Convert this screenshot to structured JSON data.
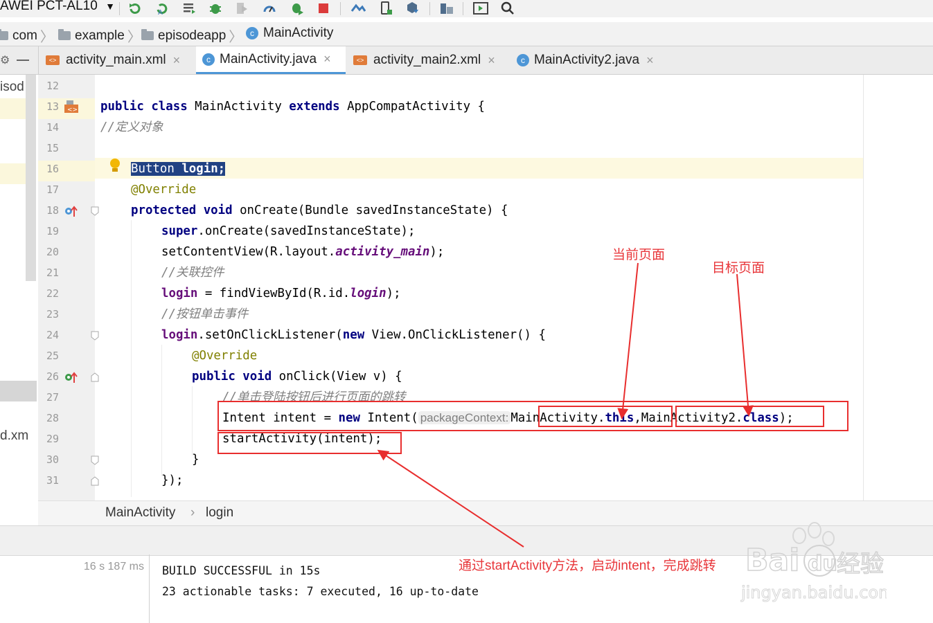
{
  "toolbar": {
    "device": "AWEI PCT-AL10"
  },
  "breadcrumb": {
    "c1": "com",
    "c2": "example",
    "c3": "episodeapp",
    "c4": "MainActivity"
  },
  "tabs": [
    {
      "label": "activity_main.xml"
    },
    {
      "label": "MainActivity.java"
    },
    {
      "label": "activity_main2.xml"
    },
    {
      "label": "MainActivity2.java"
    }
  ],
  "left_panel": {
    "t1": "isod",
    "t2": "d.xm"
  },
  "lines": [
    "12",
    "13",
    "14",
    "15",
    "16",
    "17",
    "18",
    "19",
    "20",
    "21",
    "22",
    "23",
    "24",
    "25",
    "26",
    "27",
    "28",
    "29",
    "30",
    "31"
  ],
  "code": {
    "l13_public": "public",
    "l13_class": "class",
    "l13_name": "MainActivity",
    "l13_extends": "extends",
    "l13_rest": "AppCompatActivity {",
    "l14": "//定义对象",
    "l16_sel": "Button",
    "l16_name": "login;",
    "l17": "@Override",
    "l18_kw": "protected void",
    "l18_rest": "onCreate(Bundle savedInstanceState) {",
    "l19_super": "super",
    "l19_rest": ".onCreate(savedInstanceState);",
    "l20_a": "setContentView(R.layout.",
    "l20_b": "activity_main",
    "l20_c": ");",
    "l21": "//关联控件",
    "l22_f": "login",
    "l22_a": " = findViewById(R.id.",
    "l22_b": "login",
    "l22_c": ");",
    "l23": "//按钮单击事件",
    "l24_f": "login",
    "l24_a": ".setOnClickListener(",
    "l24_new": "new",
    "l24_b": " View.OnClickListener() {",
    "l25": "@Override",
    "l26_kw": "public void",
    "l26_rest": "onClick(View v) {",
    "l27": "//单击登陆按钮后进行页面的跳转",
    "l28_a": "Intent intent = ",
    "l28_new": "new",
    "l28_b": " Intent(",
    "l28_hint": "packageContext:",
    "l28_c": "MainActivity.",
    "l28_this": "this",
    "l28_d": ",MainActivity2.",
    "l28_class": "class",
    "l28_e": ");",
    "l29": "startActivity(intent);",
    "l30": "}",
    "l31": "});"
  },
  "editor_breadcrumb": {
    "a": "MainActivity",
    "sep": "›",
    "b": "login"
  },
  "build": {
    "time": "16 s 187 ms",
    "line1": "BUILD SUCCESSFUL in 15s",
    "line2": "23 actionable tasks: 7 executed, 16 up-to-date"
  },
  "annotations": {
    "current_page": "当前页面",
    "target_page": "目标页面",
    "bottom": "通过startActivity方法，启动intent，完成跳转"
  },
  "watermark": {
    "logo": "Baidu经验",
    "url": "jingyan.baidu.com"
  },
  "colors": {
    "accent": "#4d96d6",
    "annotation_red": "#e82e2e",
    "keyword": "#000080",
    "field": "#660e7a",
    "selection": "#214283"
  }
}
